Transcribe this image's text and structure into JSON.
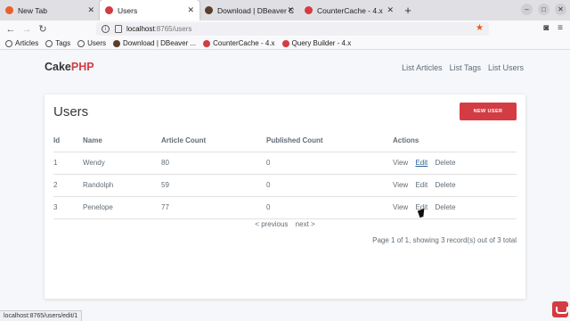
{
  "browser": {
    "tabs": [
      {
        "label": "New Tab",
        "color": "#e8602c"
      },
      {
        "label": "Users",
        "color": "#d33c43"
      },
      {
        "label": "Download | DBeaver Com",
        "color": "#5a3e2b"
      },
      {
        "label": "CounterCache - 4.x",
        "color": "#d33c43"
      }
    ],
    "url_host": "localhost",
    "url_path": ":8765/users",
    "bookmarks": [
      {
        "label": "Articles",
        "icon": "globe-icon"
      },
      {
        "label": "Tags",
        "icon": "globe-icon"
      },
      {
        "label": "Users",
        "icon": "globe-icon"
      },
      {
        "label": "Download | DBeaver ...",
        "icon": "dbeaver-icon"
      },
      {
        "label": "CounterCache - 4.x",
        "icon": "cakephp-icon"
      },
      {
        "label": "Query Builder - 4.x",
        "icon": "cakephp-icon"
      }
    ],
    "status_text": "localhost:8765/users/edit/1"
  },
  "site": {
    "brand_a": "Cake",
    "brand_b": "PHP",
    "nav": [
      "List Articles",
      "List Tags",
      "List Users"
    ]
  },
  "users": {
    "title": "Users",
    "new_button": "NEW USER",
    "headers": [
      "Id",
      "Name",
      "Article Count",
      "Published Count",
      "Actions"
    ],
    "rows": [
      {
        "id": "1",
        "name": "Wendy",
        "article_count": "80",
        "published_count": "0"
      },
      {
        "id": "2",
        "name": "Randolph",
        "article_count": "59",
        "published_count": "0"
      },
      {
        "id": "3",
        "name": "Penelope",
        "article_count": "77",
        "published_count": "0"
      }
    ],
    "actions": [
      "View",
      "Edit",
      "Delete"
    ],
    "pager_prev": "< previous",
    "pager_next": "next >",
    "counter": "Page 1 of 1, showing 3 record(s) out of 3 total"
  }
}
